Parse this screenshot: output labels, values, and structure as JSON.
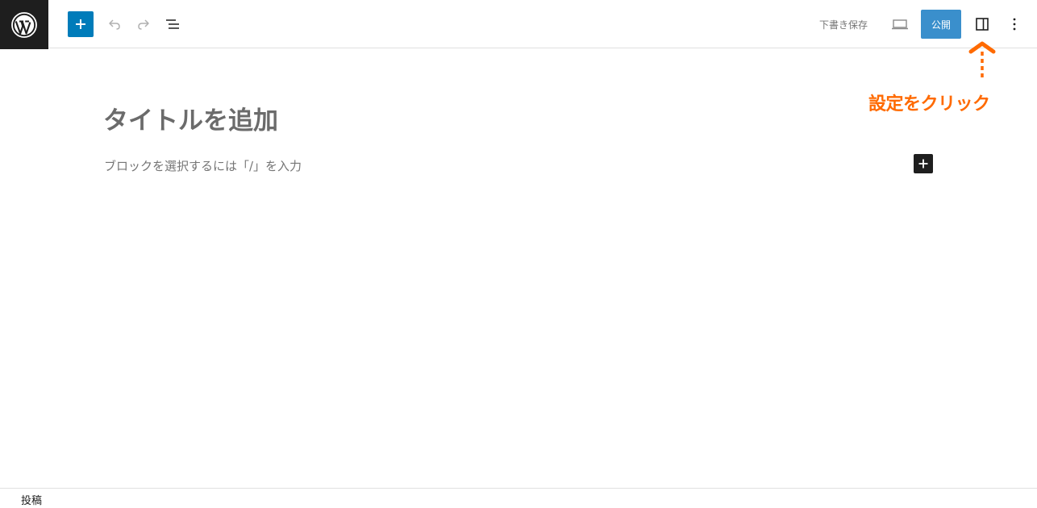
{
  "header": {
    "logo_icon": "wordpress-logo-icon",
    "add_block_icon": "plus-icon",
    "undo_icon": "undo-icon",
    "redo_icon": "redo-icon",
    "list_view_icon": "list-view-icon",
    "save_draft_label": "下書き保存",
    "preview_icon": "desktop-preview-icon",
    "publish_label": "公開",
    "settings_icon": "sidebar-settings-icon",
    "options_icon": "more-vertical-icon"
  },
  "annotation": {
    "label": "設定をクリック",
    "color": "#ff6a00"
  },
  "editor": {
    "title_placeholder": "タイトルを追加",
    "block_placeholder": "ブロックを選択するには「/」を入力",
    "block_add_icon": "plus-icon"
  },
  "footer": {
    "breadcrumb": "投稿"
  },
  "colors": {
    "accent": "#007cba",
    "publish": "#3a8fcc",
    "dark": "#1e1e1e",
    "muted": "#757575"
  }
}
